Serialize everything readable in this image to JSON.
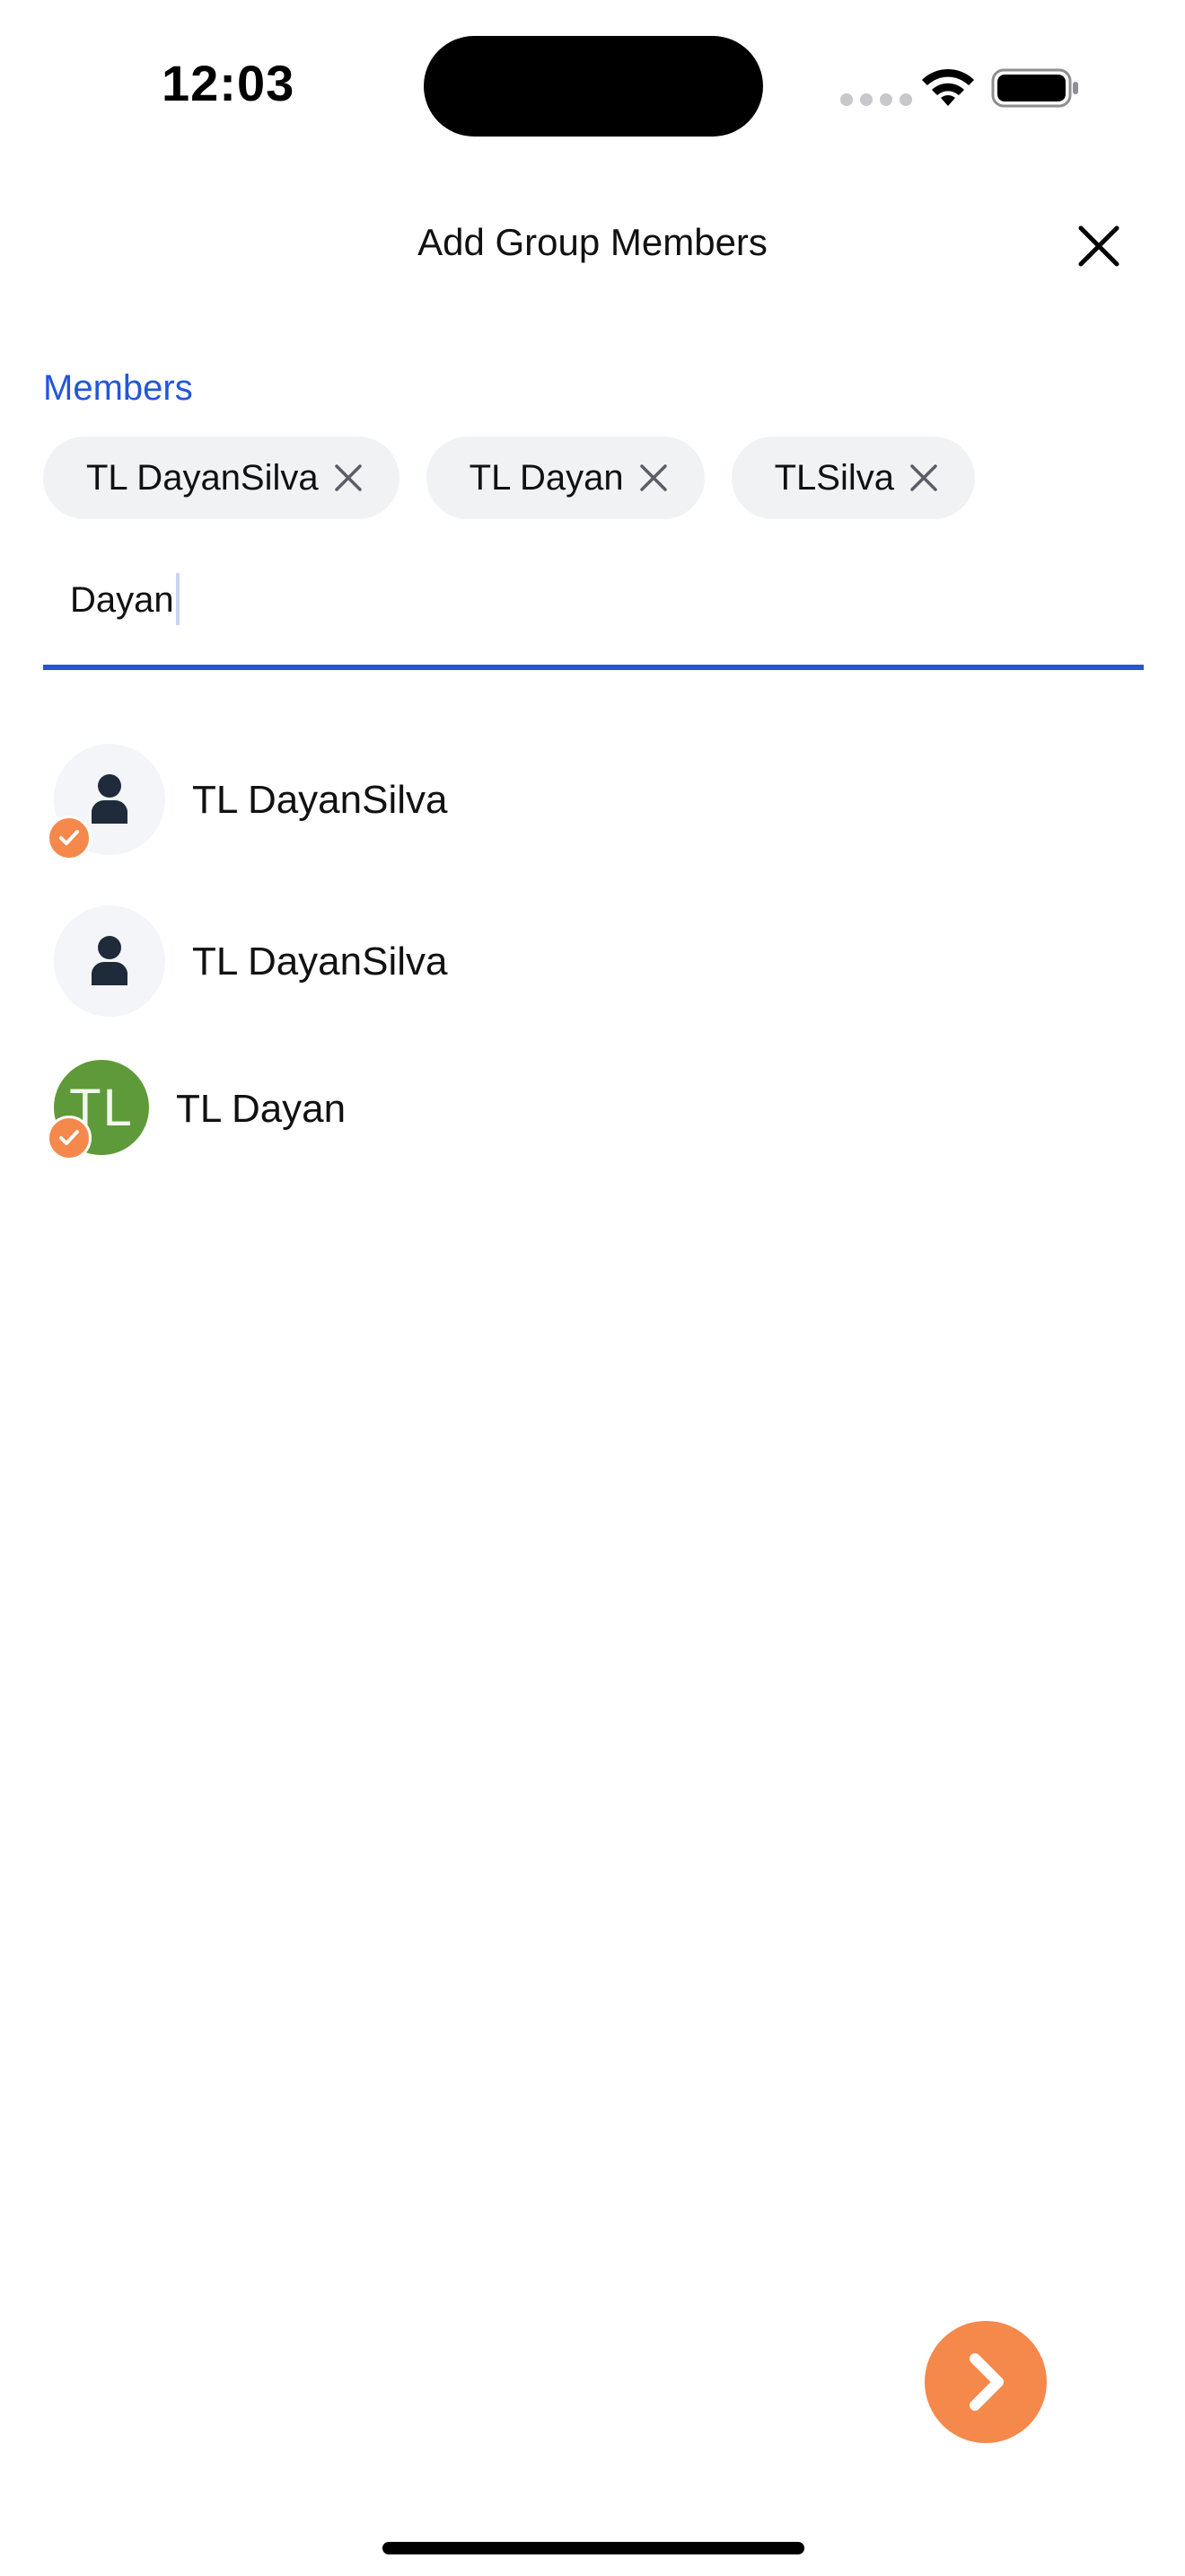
{
  "status_bar": {
    "time": "12:03"
  },
  "header": {
    "title": "Add Group Members",
    "close_icon": "close-icon"
  },
  "members": {
    "label": "Members",
    "chips": [
      {
        "label": "TL DayanSilva"
      },
      {
        "label": "TL Dayan"
      },
      {
        "label": "TLSilva"
      }
    ]
  },
  "search": {
    "value": "Dayan",
    "placeholder": ""
  },
  "results": [
    {
      "name": "TL DayanSilva",
      "avatar": "person-icon",
      "selected": true
    },
    {
      "name": "TL DayanSilva",
      "avatar": "person-icon",
      "selected": false
    },
    {
      "name": "TL Dayan",
      "avatar_initials": "TL",
      "selected": true
    }
  ],
  "colors": {
    "accent_blue": "#2357d8",
    "accent_orange": "#f5884b",
    "avatar_green": "#5f9a3a",
    "chip_background": "#f1f2f4"
  },
  "fab": {
    "icon": "chevron-right-icon"
  }
}
